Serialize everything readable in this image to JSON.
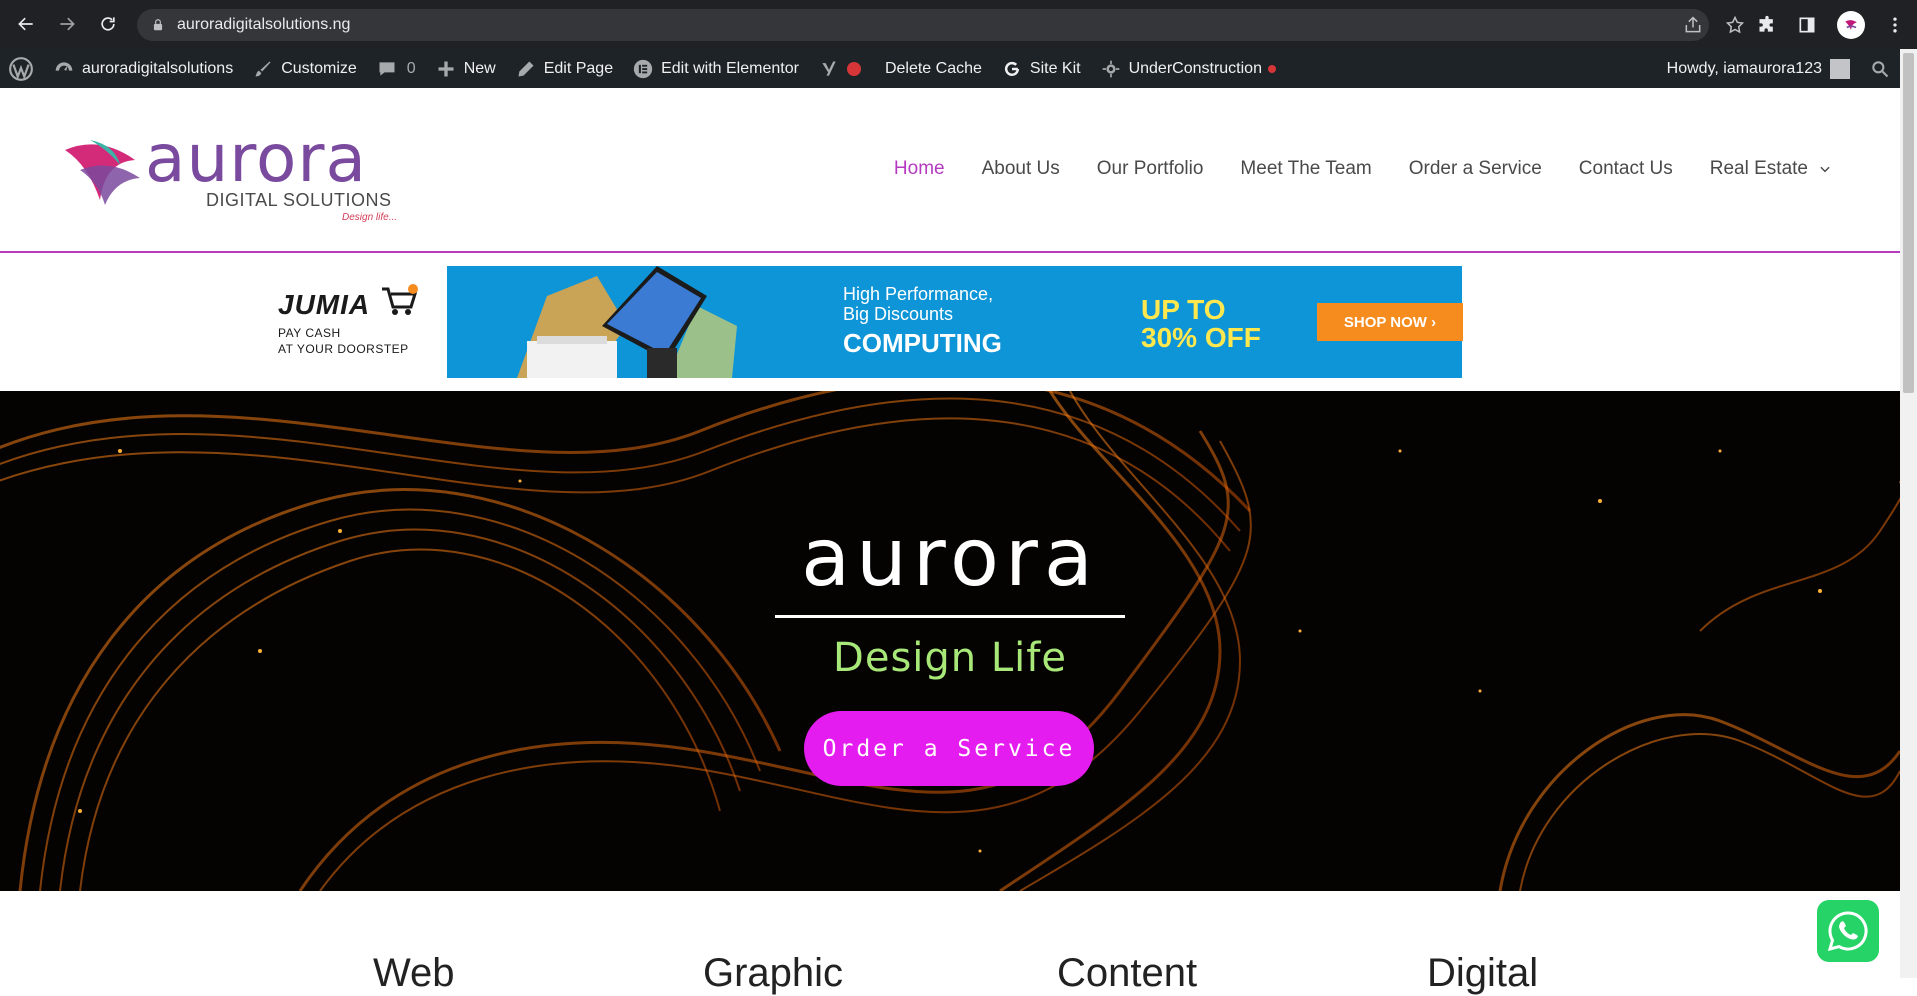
{
  "browser": {
    "url": "auroradigitalsolutions.ng"
  },
  "adminbar": {
    "site_name": "auroradigitalsolutions",
    "customize": "Customize",
    "comments_count": "0",
    "new": "New",
    "edit_page": "Edit Page",
    "edit_elementor": "Edit with Elementor",
    "delete_cache": "Delete Cache",
    "site_kit": "Site Kit",
    "under_construction": "UnderConstruction",
    "howdy": "Howdy, iamaurora123"
  },
  "header": {
    "logo_word": "aurora",
    "logo_sub": "DIGITAL SOLUTIONS",
    "logo_tag": "Design life...",
    "nav": [
      {
        "label": "Home",
        "active": true
      },
      {
        "label": "About Us"
      },
      {
        "label": "Our Portfolio"
      },
      {
        "label": "Meet The Team"
      },
      {
        "label": "Order a Service"
      },
      {
        "label": "Contact Us"
      },
      {
        "label": "Real Estate"
      }
    ]
  },
  "ad": {
    "brand": "JUMIA",
    "tagline_1": "PAY CASH",
    "tagline_2": "AT YOUR DOORSTEP",
    "headline_1": "High Performance,",
    "headline_2": "Big Discounts",
    "category": "COMPUTING",
    "offer_1": "UP TO",
    "offer_2": "30% OFF",
    "cta": "SHOP NOW ›"
  },
  "hero": {
    "title": "aurora",
    "subtitle": "Design Life",
    "button": "Order a Service"
  },
  "services": [
    "Web",
    "Graphic",
    "Content",
    "Digital"
  ],
  "colors": {
    "accent": "#b43bc0",
    "button": "#e51cf0",
    "subtitle": "#a8e879",
    "admin_bar": "#1d2327"
  }
}
